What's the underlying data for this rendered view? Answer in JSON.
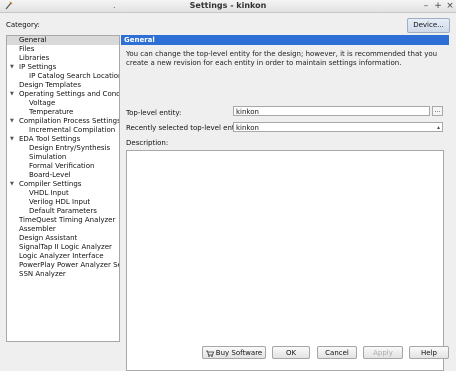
{
  "window": {
    "title": "Settings - kinkon",
    "dot": ".",
    "minimize": "–",
    "maximize": "+",
    "close": "×"
  },
  "category_label": "Category:",
  "device_button": "Device...",
  "tree": [
    {
      "label": "General",
      "level": 0,
      "selected": true
    },
    {
      "label": "Files",
      "level": 0
    },
    {
      "label": "Libraries",
      "level": 0
    },
    {
      "label": "IP Settings",
      "level": 0,
      "expanded": true
    },
    {
      "label": "IP Catalog Search Locations",
      "level": 1
    },
    {
      "label": "Design Templates",
      "level": 0
    },
    {
      "label": "Operating Settings and Conditions",
      "level": 0,
      "expanded": true
    },
    {
      "label": "Voltage",
      "level": 1
    },
    {
      "label": "Temperature",
      "level": 1
    },
    {
      "label": "Compilation Process Settings",
      "level": 0,
      "expanded": true
    },
    {
      "label": "Incremental Compilation",
      "level": 1
    },
    {
      "label": "EDA Tool Settings",
      "level": 0,
      "expanded": true
    },
    {
      "label": "Design Entry/Synthesis",
      "level": 1
    },
    {
      "label": "Simulation",
      "level": 1
    },
    {
      "label": "Formal Verification",
      "level": 1
    },
    {
      "label": "Board-Level",
      "level": 1
    },
    {
      "label": "Compiler Settings",
      "level": 0,
      "expanded": true
    },
    {
      "label": "VHDL Input",
      "level": 1
    },
    {
      "label": "Verilog HDL Input",
      "level": 1
    },
    {
      "label": "Default Parameters",
      "level": 1
    },
    {
      "label": "TimeQuest Timing Analyzer",
      "level": 0
    },
    {
      "label": "Assembler",
      "level": 0
    },
    {
      "label": "Design Assistant",
      "level": 0
    },
    {
      "label": "SignalTap II Logic Analyzer",
      "level": 0
    },
    {
      "label": "Logic Analyzer Interface",
      "level": 0
    },
    {
      "label": "PowerPlay Power Analyzer Settings",
      "level": 0
    },
    {
      "label": "SSN Analyzer",
      "level": 0
    }
  ],
  "panel": {
    "header": "General",
    "description": "You can change the top-level entity for the design; however, it is recommended that you create a new revision for each entity in order to maintain settings information.",
    "top_level_label": "Top-level entity:",
    "top_level_value": "kinkon",
    "browse_label": "...",
    "recent_label": "Recently selected top-level entities:",
    "recent_value": "kinkon",
    "desc_label": "Description:"
  },
  "buttons": {
    "buy": "Buy Software",
    "ok": "OK",
    "cancel": "Cancel",
    "apply": "Apply",
    "help": "Help"
  },
  "colors": {
    "accent": "#2e6fd6"
  }
}
